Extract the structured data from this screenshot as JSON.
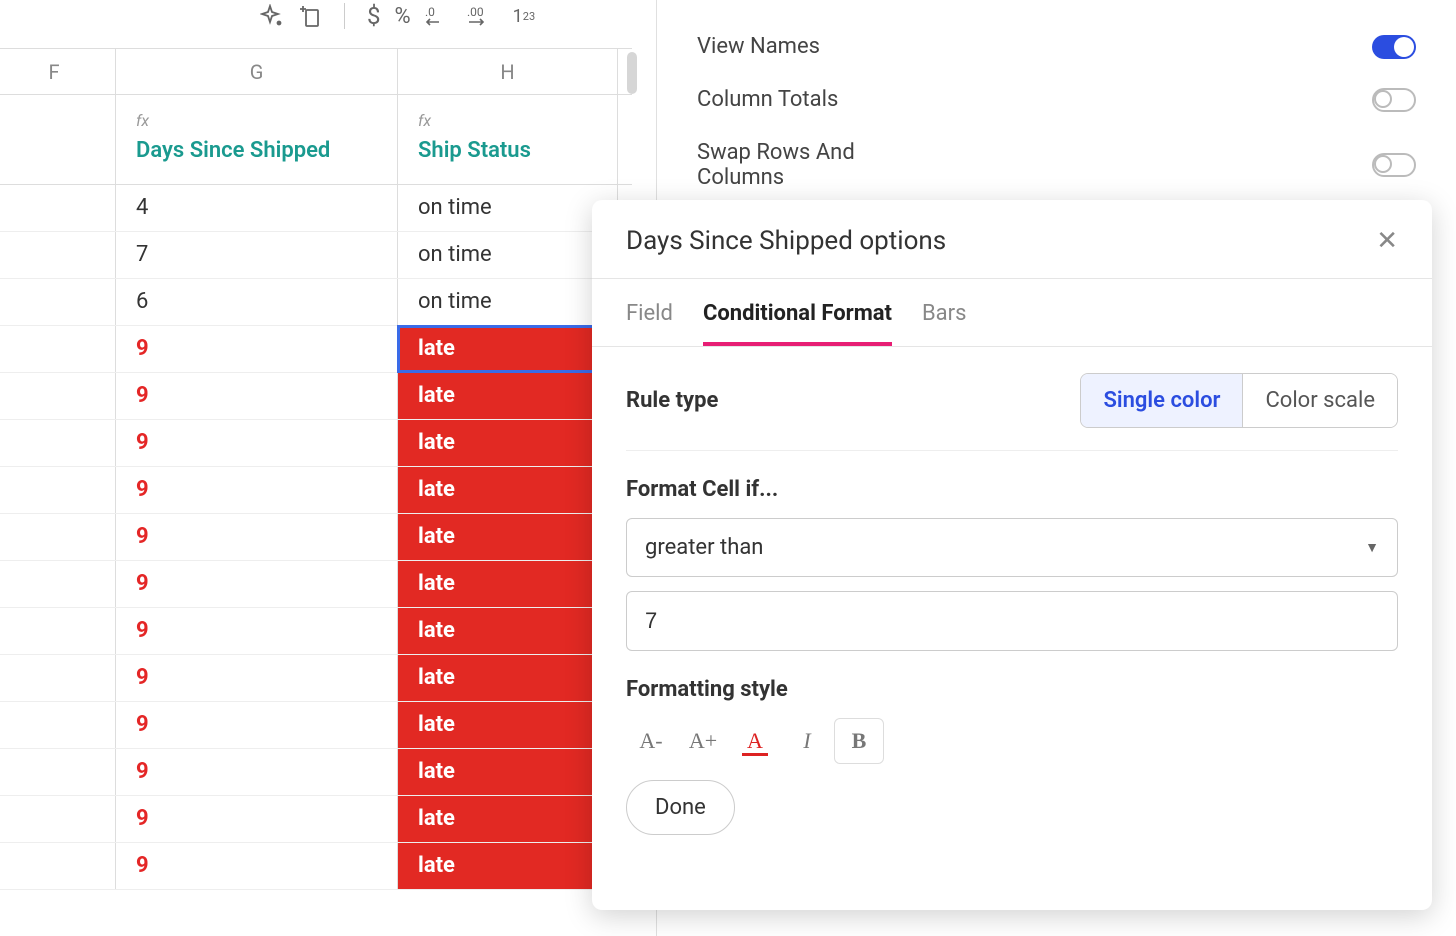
{
  "columns": {
    "F": {
      "letter": "F",
      "header": ""
    },
    "G": {
      "letter": "G",
      "fx": "fx",
      "header": "Days Since Shipped"
    },
    "H": {
      "letter": "H",
      "fx": "fx",
      "header": "Ship Status"
    }
  },
  "rows": [
    {
      "g": "4",
      "h": "on time",
      "late": false
    },
    {
      "g": "7",
      "h": "on time",
      "late": false
    },
    {
      "g": "6",
      "h": "on time",
      "late": false
    },
    {
      "g": "9",
      "h": "late",
      "late": true,
      "selected": true
    },
    {
      "g": "9",
      "h": "late",
      "late": true
    },
    {
      "g": "9",
      "h": "late",
      "late": true
    },
    {
      "g": "9",
      "h": "late",
      "late": true
    },
    {
      "g": "9",
      "h": "late",
      "late": true
    },
    {
      "g": "9",
      "h": "late",
      "late": true
    },
    {
      "g": "9",
      "h": "late",
      "late": true
    },
    {
      "g": "9",
      "h": "late",
      "late": true
    },
    {
      "g": "9",
      "h": "late",
      "late": true
    },
    {
      "g": "9",
      "h": "late",
      "late": true
    },
    {
      "g": "9",
      "h": "late",
      "late": true
    },
    {
      "g": "9",
      "h": "late",
      "late": true
    }
  ],
  "sidePanel": {
    "viewNames": {
      "label": "View Names",
      "on": true
    },
    "columnTotals": {
      "label": "Column Totals",
      "on": false
    },
    "swapRowsCols": {
      "label": "Swap Rows And Columns",
      "on": false
    }
  },
  "popover": {
    "title": "Days Since Shipped options",
    "tabs": {
      "field": "Field",
      "conditional": "Conditional Format",
      "bars": "Bars",
      "active": "conditional"
    },
    "ruleTypeLabel": "Rule type",
    "ruleTypeOptions": {
      "single": "Single color",
      "scale": "Color scale",
      "active": "single"
    },
    "formatIfLabel": "Format Cell if...",
    "condition": "greater than",
    "value": "7",
    "formattingStyleLabel": "Formatting style",
    "fmtButtons": {
      "decrease": "A-",
      "increase": "A+",
      "color": "A",
      "italic": "I",
      "bold": "B"
    },
    "done": "Done"
  },
  "toolbar": {
    "sparkle": "✧₊",
    "insert": "+[]",
    "currency": "$",
    "percent": "%",
    "decMinus": ".0←",
    "decPlus": ".00",
    "fraction": "1²₃"
  }
}
